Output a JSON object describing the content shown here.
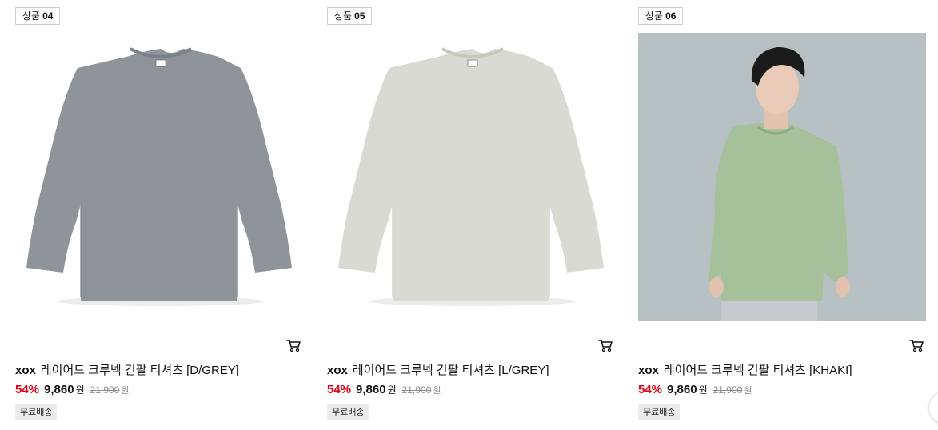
{
  "products": [
    {
      "badge_label": "상품",
      "badge_num": "04",
      "brand": "xox",
      "name": "레이어드 크루넥 긴팔 티셔츠 [D/GREY]",
      "discount": "54%",
      "sale_price": "9,860",
      "currency": "원",
      "original_price": "21,900",
      "shipping": "무료배송",
      "image_kind": "flat-tshirt",
      "shirt_color": "#8e949a",
      "shirt_shade": "#7b8187",
      "bg_color": "#ffffff"
    },
    {
      "badge_label": "상품",
      "badge_num": "05",
      "brand": "xox",
      "name": "레이어드 크루넥 긴팔 티셔츠 [L/GREY]",
      "discount": "54%",
      "sale_price": "9,860",
      "currency": "원",
      "original_price": "21,900",
      "shipping": "무료배송",
      "image_kind": "flat-tshirt",
      "shirt_color": "#d9dbd2",
      "shirt_shade": "#c5c8bd",
      "bg_color": "#ffffff"
    },
    {
      "badge_label": "상품",
      "badge_num": "06",
      "brand": "xox",
      "name": "레이어드 크루넥 긴팔 티셔츠 [KHAKI]",
      "discount": "54%",
      "sale_price": "9,860",
      "currency": "원",
      "original_price": "21,900",
      "shipping": "무료배송",
      "image_kind": "model-photo",
      "shirt_color": "#a6c09a",
      "shirt_shade": "#8fab84",
      "bg_color": "#b7c0c3"
    }
  ],
  "icons": {
    "cart": "cart-icon"
  },
  "colors": {
    "discount": "#e60012",
    "badge_border": "#cfcfcf",
    "shipping_bg": "#ececec",
    "original_price": "#8a8a8a"
  }
}
